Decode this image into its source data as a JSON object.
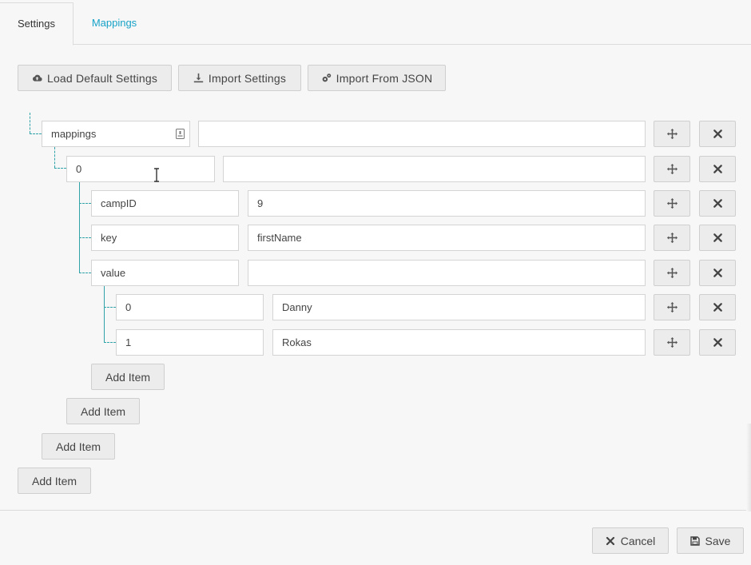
{
  "tabs": [
    {
      "label": "Settings",
      "active": true
    },
    {
      "label": "Mappings",
      "active": false
    }
  ],
  "toolbar": {
    "load_default": "Load Default Settings",
    "import_settings": "Import Settings",
    "import_json": "Import From JSON"
  },
  "tree": {
    "rows": [
      {
        "key": "mappings",
        "value": ""
      },
      {
        "key": "0",
        "value": ""
      },
      {
        "key": "campID",
        "value": "9"
      },
      {
        "key": "key",
        "value": "firstName"
      },
      {
        "key": "value",
        "value": ""
      },
      {
        "key": "0",
        "value": "Danny"
      },
      {
        "key": "1",
        "value": "Rokas"
      }
    ],
    "add_item_label": "Add Item"
  },
  "footer": {
    "cancel_label": "Cancel",
    "save_label": "Save"
  },
  "colors": {
    "accent": "#17a2c7",
    "tree_line": "#2fa3a8"
  }
}
